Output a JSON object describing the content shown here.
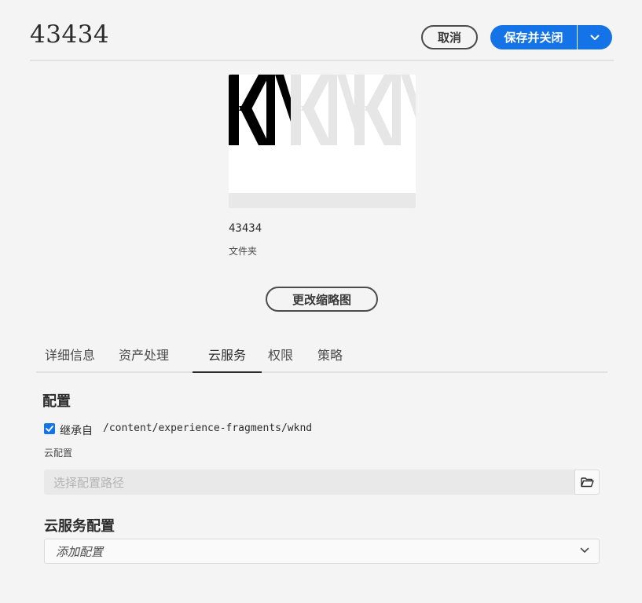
{
  "header": {
    "title": "43434",
    "cancel_label": "取消",
    "save_label": "保存并关闭"
  },
  "asset": {
    "thumbnail_text": "KN",
    "name": "43434",
    "type": "文件夹",
    "change_thumbnail_label": "更改缩略图"
  },
  "tabs": [
    {
      "label": "详细信息",
      "active": false
    },
    {
      "label": "资产处理",
      "active": false
    },
    {
      "label": "云服务",
      "active": true
    },
    {
      "label": "权限",
      "active": false
    },
    {
      "label": "策略",
      "active": false
    }
  ],
  "config": {
    "section_title": "配置",
    "inherit_checked": true,
    "inherit_label": "继承自",
    "inherit_path": "/content/experience-fragments/wknd",
    "cloud_config_label": "云配置",
    "path_placeholder": "选择配置路径"
  },
  "cloud_services": {
    "section_title": "云服务配置",
    "select_placeholder": "添加配置"
  },
  "colors": {
    "accent": "#1473e6",
    "background": "#f4f4f4"
  }
}
